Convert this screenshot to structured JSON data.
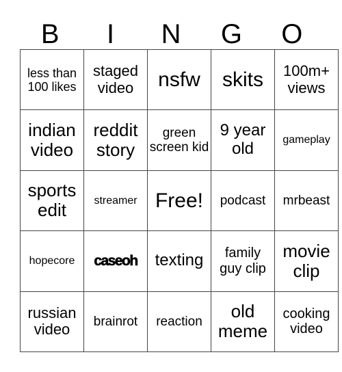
{
  "header": {
    "letters": [
      "B",
      "I",
      "N",
      "G",
      "O"
    ]
  },
  "card": {
    "rows": [
      [
        "less than 100 likes",
        "staged video",
        "nsfw",
        "skits",
        "100m+ views"
      ],
      [
        "indian video",
        "reddit story",
        "green screen kid",
        "9 year old",
        "gameplay"
      ],
      [
        "sports edit",
        "streamer",
        "Free!",
        "podcast",
        "mrbeast"
      ],
      [
        "hopecore",
        "caseoh",
        "texting",
        "family guy clip",
        "movie clip"
      ],
      [
        "russian video",
        "brainrot",
        "reaction",
        "old meme",
        "cooking video"
      ]
    ]
  }
}
